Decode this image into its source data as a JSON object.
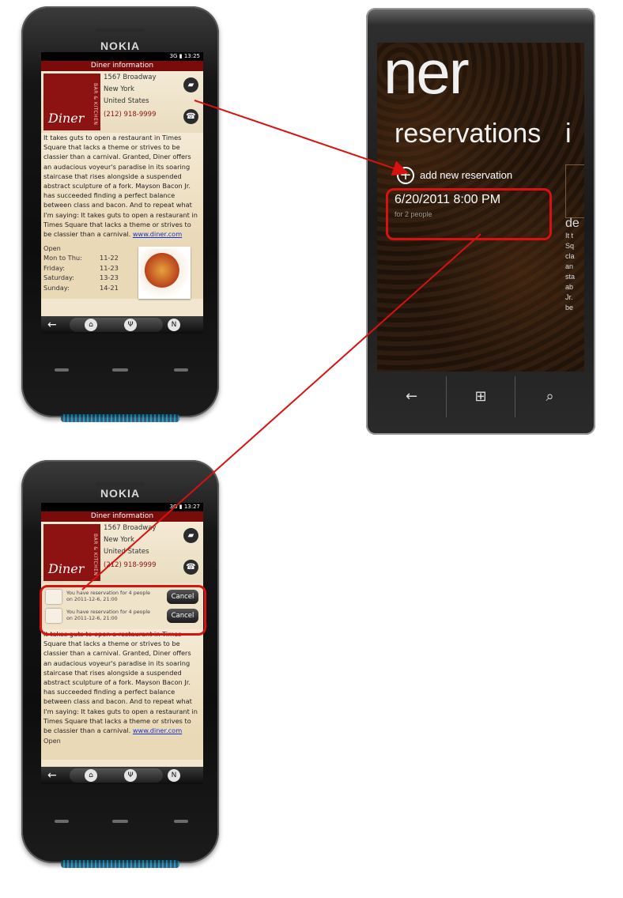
{
  "nokia_top": {
    "brand": "NOKIA",
    "status_time": "13:25",
    "status_signal": "3G",
    "title": "Diner information",
    "logo_text": "Diner",
    "logo_sub": "BAR & KITCHEN",
    "address_line1": "1567 Broadway",
    "address_line2": "New York",
    "address_line3": "United States",
    "phone": "(212) 918-9999",
    "description": "It takes guts to open a restaurant in Times Square that lacks a theme or strives to be classier than a carnival. Granted, Diner offers an audacious voyeur's paradise in its soaring staircase that rises alongside a suspended abstract sculpture of a fork. Mayson Bacon Jr. has succeeded finding a perfect balance between class and bacon. And to repeat what I'm saying: It takes guts to open a restaurant in Times Square that lacks a theme or strives to be classier than a carnival.",
    "link": "www.diner.com",
    "open_label": "Open",
    "hours": [
      {
        "day": "Mon to Thu:",
        "time": "11-22"
      },
      {
        "day": "Friday:",
        "time": "11-23"
      },
      {
        "day": "Saturday:",
        "time": "13-23"
      },
      {
        "day": "Sunday:",
        "time": "14-21"
      }
    ]
  },
  "nokia_bottom": {
    "brand": "NOKIA",
    "status_time": "13:27",
    "status_signal": "3G",
    "title": "Diner information",
    "logo_text": "Diner",
    "logo_sub": "BAR & KITCHEN",
    "address_line1": "1567 Broadway",
    "address_line2": "New York",
    "address_line3": "United States",
    "phone": "(212) 918-9999",
    "reservations": [
      {
        "line1": "You have reservation for 4 people",
        "line2": "on 2011-12-6, 21:00",
        "button": "Cancel"
      },
      {
        "line1": "You have reservation for 4 people",
        "line2": "on 2011-12-6, 21:00",
        "button": "Cancel"
      }
    ],
    "description": "It takes guts to open a restaurant in Times Square that lacks a theme or strives to be classier than a carnival. Granted, Diner offers an audacious voyeur's paradise in its soaring staircase that rises alongside a suspended abstract sculpture of a fork. Mayson Bacon Jr. has succeeded finding a perfect balance between class and bacon. And to repeat what I'm saying: It takes guts to open a restaurant in Times Square that lacks a theme or strives to be classier than a carnival.",
    "link": "www.diner.com",
    "open_label": "Open"
  },
  "wp7": {
    "app_title": "ner",
    "section": "reservations",
    "next_section": "i",
    "add_label": "add new reservation",
    "reservation_date": "6/20/2011 8:00 PM",
    "reservation_people": "for 2 people",
    "peek_title": "de",
    "peek_lines": [
      "It t",
      "Sq",
      "cla",
      "an",
      "sta",
      "ab",
      "Jr.",
      "be"
    ]
  },
  "colors": {
    "highlight": "#d9110f",
    "nokia_title": "#7a0b0b",
    "link": "#1633c9"
  }
}
